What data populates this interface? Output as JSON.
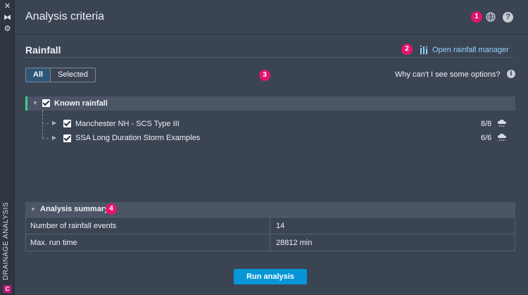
{
  "strip": {
    "label": "DRAINAGE ANALYSIS",
    "close_glyph": "✕",
    "pin_glyph": "⧓",
    "settings_glyph": "⚙",
    "badge_letter": "C"
  },
  "header": {
    "title": "Analysis criteria",
    "badge": "1",
    "icons": [
      "globe-icon",
      "help-icon"
    ],
    "help_glyph": "?"
  },
  "rainfall": {
    "title": "Rainfall",
    "badge": "2",
    "manager_link": "Open rainfall manager",
    "filter": {
      "options": [
        "All",
        "Selected"
      ],
      "selected": "All"
    },
    "badge3": "3",
    "why_text": "Why can't I see some options?",
    "info_glyph": "i",
    "group": {
      "label": "Known rainfall",
      "checked": true,
      "items": [
        {
          "label": "Manchester NH - SCS Type III",
          "count": "8/8",
          "checked": true
        },
        {
          "label": "SSA Long Duration Storm Examples",
          "count": "6/6",
          "checked": true
        }
      ]
    }
  },
  "summary": {
    "title": "Analysis summary",
    "badge": "4",
    "rows": [
      {
        "label": "Number of rainfall events",
        "value": "14"
      },
      {
        "label": "Max. run time",
        "value": "28812 min"
      }
    ]
  },
  "actions": {
    "run_label": "Run analysis"
  },
  "colors": {
    "accent": "#0696d7",
    "badge": "#e4156e",
    "group_accent": "#3fcf8e",
    "link": "#8fd3ff"
  }
}
